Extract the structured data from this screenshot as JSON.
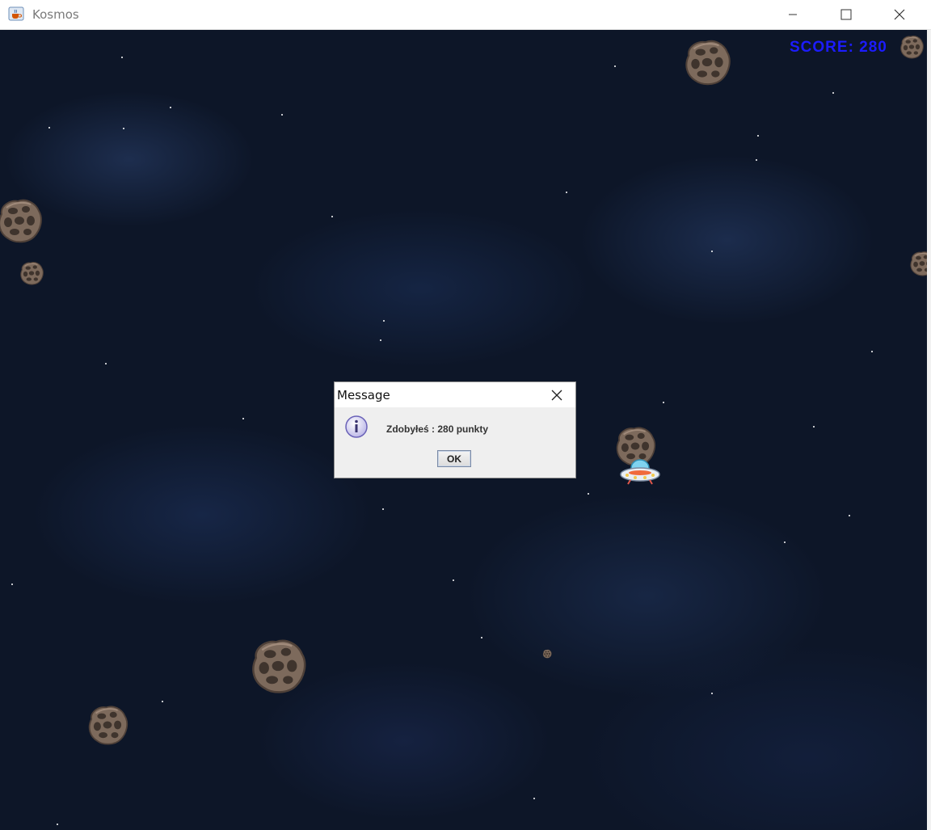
{
  "window": {
    "title": "Kosmos",
    "app_icon": "java-cup-icon",
    "controls": [
      "minimize-icon",
      "maximize-icon",
      "close-icon"
    ]
  },
  "game": {
    "score_text": "SCORE: 280",
    "score_color": "#1c1cff",
    "background_color": "#0d1628",
    "sprites": {
      "asteroid": "asteroid-icon",
      "player": "ufo-spaceship-icon"
    }
  },
  "dialog": {
    "title": "Message",
    "icon": "info-icon",
    "message": "Zdobyłeś : 280 punkty",
    "ok_label": "OK"
  }
}
